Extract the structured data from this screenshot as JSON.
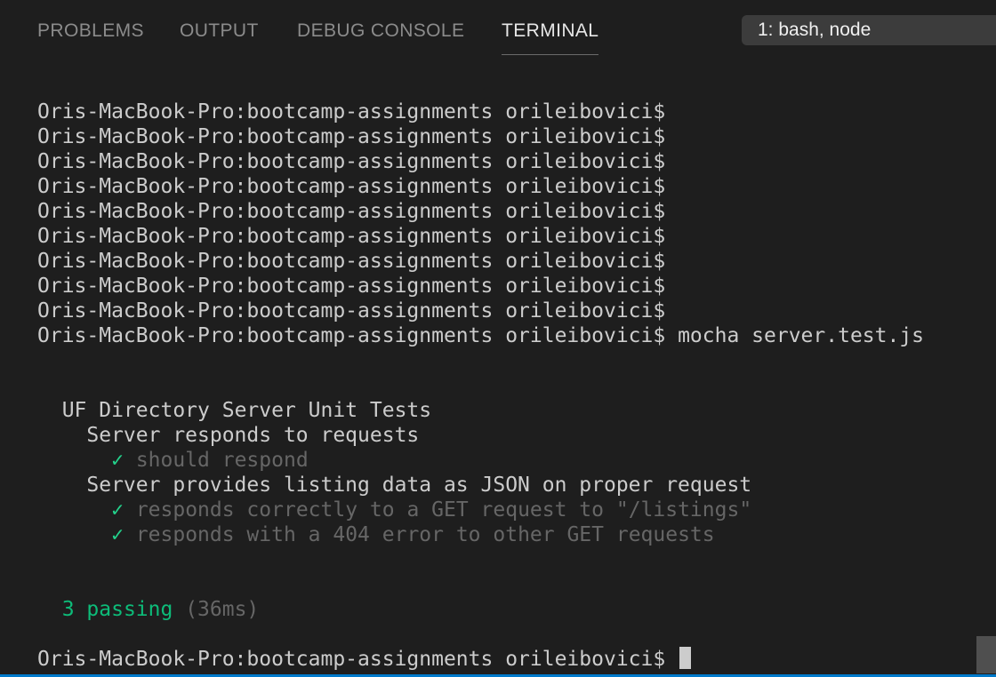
{
  "panel": {
    "tabs": [
      {
        "label": "PROBLEMS",
        "active": false
      },
      {
        "label": "OUTPUT",
        "active": false
      },
      {
        "label": "DEBUG CONSOLE",
        "active": false
      },
      {
        "label": "TERMINAL",
        "active": true
      }
    ],
    "terminal_selector": "1: bash, node"
  },
  "terminal": {
    "prompt": "Oris-MacBook-Pro:bootcamp-assignments orileibovici$",
    "empty_prompt_count": 9,
    "command": "mocha server.test.js",
    "suite_title": "UF Directory Server Unit Tests",
    "groups": [
      {
        "title": "Server responds to requests",
        "tests": [
          "should respond"
        ]
      },
      {
        "title": "Server provides listing data as JSON on proper request",
        "tests": [
          "responds correctly to a GET request to \"/listings\"",
          "responds with a 404 error to other GET requests"
        ]
      }
    ],
    "check_glyph": "✓",
    "passing_text": "3 passing",
    "duration_text": "(36ms)"
  },
  "colors": {
    "background": "#1e1e1e",
    "text": "#cccccc",
    "pass_green": "#0dbc79",
    "dim_gray": "#666666",
    "accent_blue": "#007acc"
  }
}
